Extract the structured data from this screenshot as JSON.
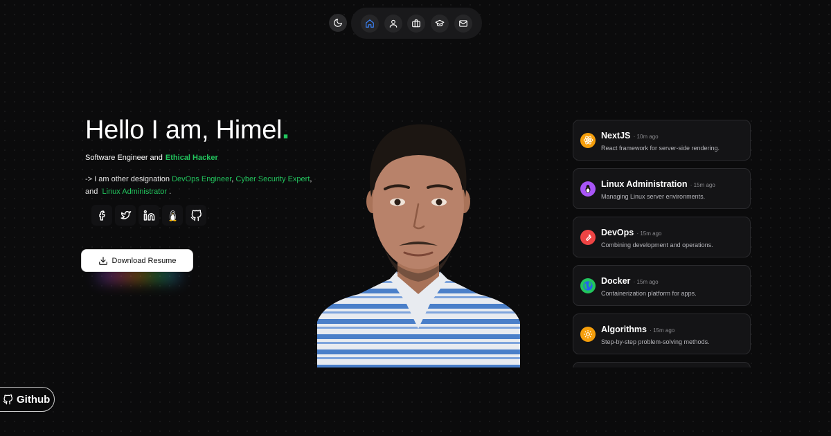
{
  "nav": {
    "theme_icon": "moon-icon",
    "items": [
      {
        "icon": "home-icon",
        "active": true
      },
      {
        "icon": "user-icon"
      },
      {
        "icon": "briefcase-icon"
      },
      {
        "icon": "graduation-cap-icon"
      },
      {
        "icon": "mail-icon"
      }
    ]
  },
  "hero": {
    "title_text": "Hello I am, Himel",
    "title_dot": ".",
    "subtitle_prefix": "Software Engineer and",
    "subtitle_accent": "Ethical Hacker",
    "desc_prefix": "-> I am other designation",
    "desc_role1": "DevOps Engineer",
    "desc_sep1": ",",
    "desc_role2": "Cyber Security Expert",
    "desc_sep2": ",",
    "desc_and": "and",
    "desc_role3": "Linux Administrator",
    "desc_end": ".",
    "socials": [
      "facebook-icon",
      "twitter-icon",
      "linkedin-icon",
      "linux-tux-icon",
      "github-icon"
    ],
    "download_label": "Download Resume"
  },
  "cards": [
    {
      "title": "NextJS",
      "time": "10m ago",
      "desc": "React framework for server-side rendering.",
      "icon": "react-atom-icon",
      "color": "#f59e0b"
    },
    {
      "title": "Linux Administration",
      "time": "15m ago",
      "desc": "Managing Linux server environments.",
      "icon": "tux-penguin-icon",
      "color": "#a855f7"
    },
    {
      "title": "DevOps",
      "time": "15m ago",
      "desc": "Combining development and operations.",
      "icon": "wrench-icon",
      "color": "#ef4444"
    },
    {
      "title": "Docker",
      "time": "15m ago",
      "desc": "Containerization platform for apps.",
      "icon": "globe-icon",
      "color": "#22c55e"
    },
    {
      "title": "Algorithms",
      "time": "15m ago",
      "desc": "Step-by-step problem-solving methods.",
      "icon": "gear-icon",
      "color": "#f59e0b"
    }
  ],
  "github_badge": {
    "label": "Github"
  },
  "colors": {
    "accent": "#22c55e",
    "active_nav": "#3b82f6",
    "background": "#0b0b0c"
  }
}
